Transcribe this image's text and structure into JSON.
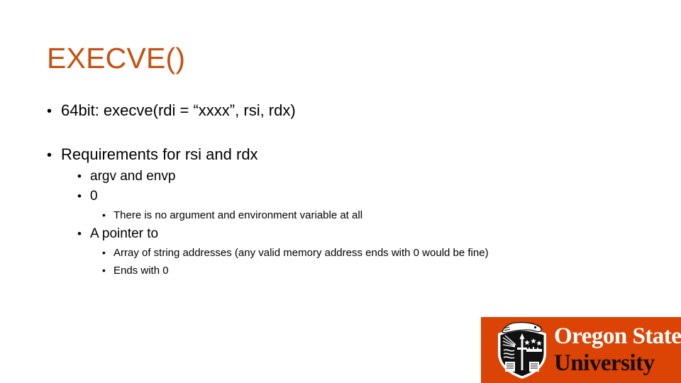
{
  "slide": {
    "title": "EXECVE()",
    "title_color": "#C8500F",
    "background": "#ffffff",
    "body": [
      {
        "level": 1,
        "text": "64bit: execve(rdi = “xxxx”, rsi, rdx)"
      },
      {
        "level": 1,
        "text": "Requirements for rsi and rdx"
      },
      {
        "level": 2,
        "text": "argv and envp"
      },
      {
        "level": 2,
        "text": "0"
      },
      {
        "level": 3,
        "text": "There is no argument and environment variable at all"
      },
      {
        "level": 2,
        "text": "A pointer to"
      },
      {
        "level": 3,
        "text": "Array of string addresses (any valid memory address ends with 0 would be fine)"
      },
      {
        "level": 3,
        "text": "Ends with 0"
      }
    ],
    "bullet_glyph": "•"
  },
  "logo": {
    "name": "oregon-state-university-logo",
    "line1": "Oregon State",
    "line2": "University",
    "background_color": "#DC4405",
    "line1_color": "#FFFFFF",
    "line2_color": "#1A0D06",
    "crest_alt": "beaver-shield-crest"
  }
}
